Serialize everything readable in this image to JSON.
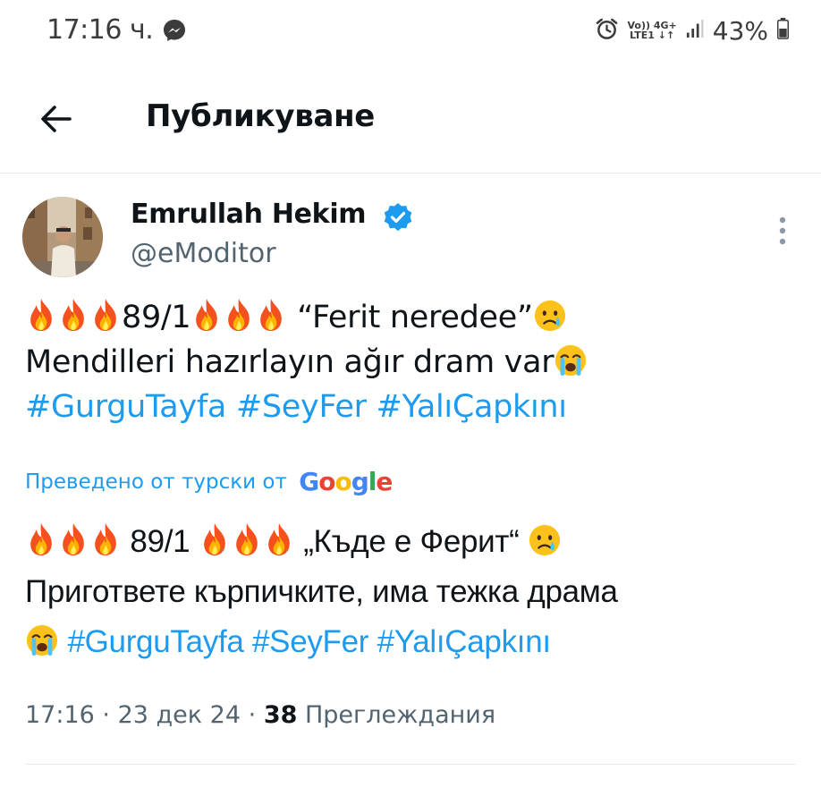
{
  "status_bar": {
    "time": "17:16 ч.",
    "network_top": "Vo)) 4G+",
    "network_bottom": "LTE1 ↓↑",
    "battery": "43%"
  },
  "header": {
    "title": "Публикуване"
  },
  "tweet": {
    "author_name": "Emrullah Hekim",
    "handle": "@eModitor",
    "original": {
      "line1_count": "89/1",
      "line1_quote": " “Ferit neredee”",
      "line2": "Mendilleri hazırlayın ağır dram var",
      "hashtags": [
        "#GurguTayfa",
        "#SeyFer",
        "#YalıÇapkını"
      ]
    },
    "translation_label": "Преведено от турски от",
    "translation_provider": "Google",
    "translated": {
      "line1_count": " 89/1 ",
      "line1_quote": " „Къде е Ферит“ ",
      "line2": "Пригответе кърпичките, има тежка драма",
      "hashtags": [
        "#GurguTayfa",
        "#SeyFer",
        "#YalıÇapkını"
      ]
    },
    "time": "17:16",
    "date": "23 дек 24",
    "views_count": "38",
    "views_label": "Преглеждания"
  },
  "icons": {
    "back": "arrow-left-icon",
    "verified": "verified-badge-icon",
    "more": "more-vertical-icon",
    "fire": "fire-emoji",
    "crying": "crying-face-emoji",
    "sobbing": "sobbing-face-emoji"
  },
  "colors": {
    "accent": "#1d9bf0",
    "text": "#0f1419",
    "secondary": "#536471"
  }
}
